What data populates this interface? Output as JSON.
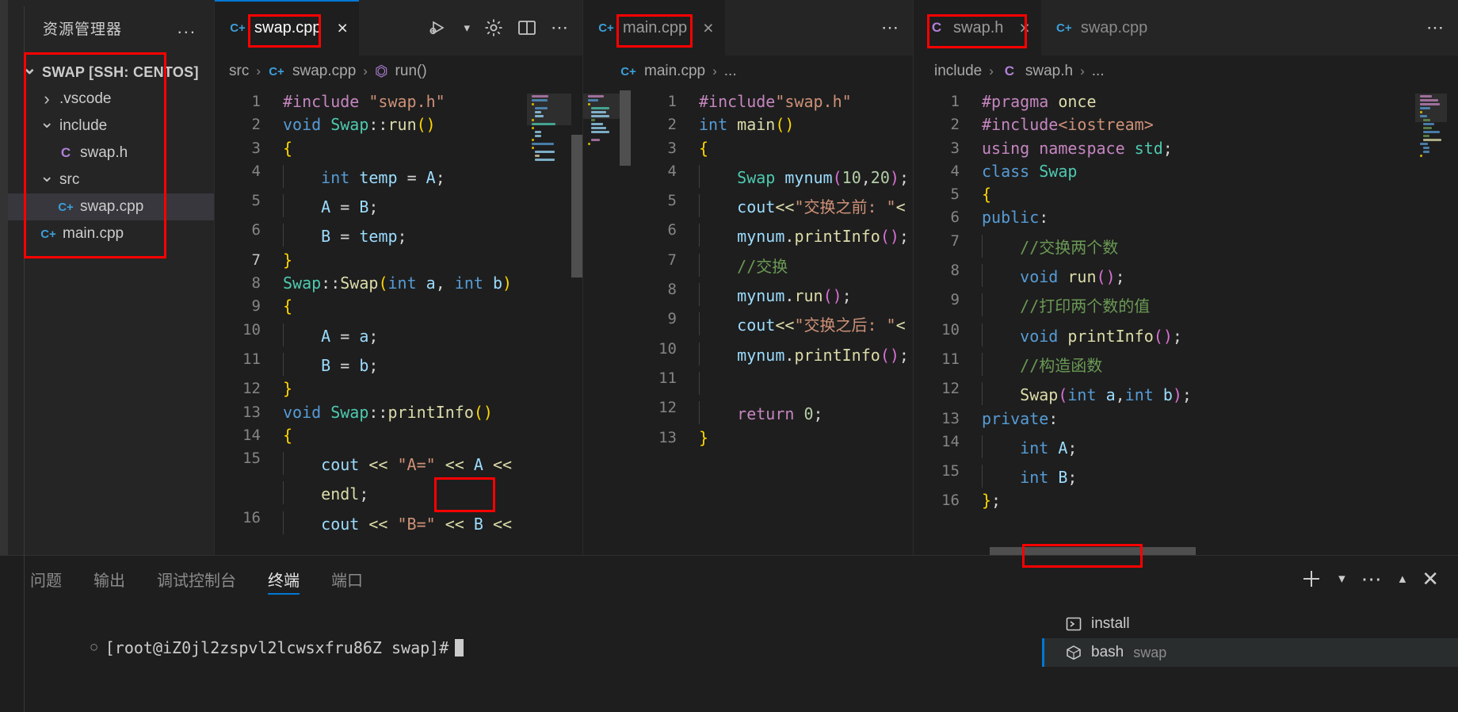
{
  "sidebar": {
    "title": "资源管理器",
    "more_label": "...",
    "root": "SWAP [SSH: CENTOS]",
    "items": [
      {
        "label": ".vscode",
        "kind": "folder",
        "state": "collapsed"
      },
      {
        "label": "include",
        "kind": "folder",
        "state": "expanded"
      },
      {
        "label": "swap.h",
        "kind": "header",
        "icon": "C"
      },
      {
        "label": "src",
        "kind": "folder",
        "state": "expanded"
      },
      {
        "label": "swap.cpp",
        "kind": "cpp",
        "icon": "C+",
        "selected": true
      },
      {
        "label": "main.cpp",
        "kind": "cpp",
        "icon": "C+"
      }
    ]
  },
  "groups": [
    {
      "tabs": [
        {
          "label": "swap.cpp",
          "icon": "cpp-file-icon",
          "active": true,
          "close": "×"
        }
      ],
      "actions": [
        "run-and-debug-icon",
        "chevron-down-icon",
        "gear-icon",
        "split-editor-icon",
        "more-actions-icon"
      ],
      "breadcrumb": [
        "src",
        "swap.cpp",
        "run()"
      ],
      "lines": [
        {
          "n": "1",
          "tokens": [
            {
              "t": "#include ",
              "c": "pp"
            },
            {
              "t": "\"swap.h\"",
              "c": "str"
            }
          ]
        },
        {
          "n": "2",
          "tokens": [
            {
              "t": "void ",
              "c": "kw"
            },
            {
              "t": "Swap",
              "c": "typ"
            },
            {
              "t": "::",
              "c": "op"
            },
            {
              "t": "run",
              "c": "fn"
            },
            {
              "t": "(",
              "c": "b1"
            },
            {
              "t": ")",
              "c": "b1"
            }
          ]
        },
        {
          "n": "3",
          "tokens": [
            {
              "t": "{",
              "c": "b1"
            }
          ]
        },
        {
          "n": "4",
          "indent": 1,
          "tokens": [
            {
              "t": "int ",
              "c": "kw"
            },
            {
              "t": "temp ",
              "c": "var"
            },
            {
              "t": "= ",
              "c": "op"
            },
            {
              "t": "A",
              "c": "var"
            },
            {
              "t": ";",
              "c": "op"
            }
          ]
        },
        {
          "n": "5",
          "indent": 1,
          "tokens": [
            {
              "t": "A ",
              "c": "var"
            },
            {
              "t": "= ",
              "c": "op"
            },
            {
              "t": "B",
              "c": "var"
            },
            {
              "t": ";",
              "c": "op"
            }
          ]
        },
        {
          "n": "6",
          "indent": 1,
          "tokens": [
            {
              "t": "B ",
              "c": "var"
            },
            {
              "t": "= ",
              "c": "op"
            },
            {
              "t": "temp",
              "c": "var"
            },
            {
              "t": ";",
              "c": "op"
            }
          ]
        },
        {
          "n": "7",
          "current": true,
          "tokens": [
            {
              "t": "}",
              "c": "b1"
            }
          ]
        },
        {
          "n": "8",
          "tokens": [
            {
              "t": "Swap",
              "c": "typ"
            },
            {
              "t": "::",
              "c": "op"
            },
            {
              "t": "Swap",
              "c": "fn"
            },
            {
              "t": "(",
              "c": "b1"
            },
            {
              "t": "int ",
              "c": "kw"
            },
            {
              "t": "a",
              "c": "var"
            },
            {
              "t": ", ",
              "c": "op"
            },
            {
              "t": "int ",
              "c": "kw"
            },
            {
              "t": "b",
              "c": "var"
            },
            {
              "t": ")",
              "c": "b1"
            }
          ]
        },
        {
          "n": "9",
          "tokens": [
            {
              "t": "{",
              "c": "b1"
            }
          ]
        },
        {
          "n": "10",
          "indent": 1,
          "tokens": [
            {
              "t": "A ",
              "c": "var"
            },
            {
              "t": "= ",
              "c": "op"
            },
            {
              "t": "a",
              "c": "var"
            },
            {
              "t": ";",
              "c": "op"
            }
          ]
        },
        {
          "n": "11",
          "indent": 1,
          "tokens": [
            {
              "t": "B ",
              "c": "var"
            },
            {
              "t": "= ",
              "c": "op"
            },
            {
              "t": "b",
              "c": "var"
            },
            {
              "t": ";",
              "c": "op"
            }
          ]
        },
        {
          "n": "12",
          "tokens": [
            {
              "t": "}",
              "c": "b1"
            }
          ]
        },
        {
          "n": "13",
          "tokens": [
            {
              "t": "void ",
              "c": "kw"
            },
            {
              "t": "Swap",
              "c": "typ"
            },
            {
              "t": "::",
              "c": "op"
            },
            {
              "t": "printInfo",
              "c": "fn"
            },
            {
              "t": "(",
              "c": "b1"
            },
            {
              "t": ")",
              "c": "b1"
            }
          ]
        },
        {
          "n": "14",
          "tokens": [
            {
              "t": "{",
              "c": "b1"
            }
          ]
        },
        {
          "n": "15",
          "indent": 1,
          "tokens": [
            {
              "t": "cout ",
              "c": "var"
            },
            {
              "t": "<< ",
              "c": "fn"
            },
            {
              "t": "\"A=\"",
              "c": "str"
            },
            {
              "t": " << ",
              "c": "fn"
            },
            {
              "t": "A",
              "c": "var"
            },
            {
              "t": " <<",
              "c": "fn"
            }
          ]
        },
        {
          "n": "",
          "indent": 1,
          "tokens": [
            {
              "t": "endl",
              "c": "fn"
            },
            {
              "t": ";",
              "c": "op"
            }
          ]
        },
        {
          "n": "16",
          "indent": 1,
          "tokens": [
            {
              "t": "cout ",
              "c": "var"
            },
            {
              "t": "<< ",
              "c": "fn"
            },
            {
              "t": "\"B=\"",
              "c": "str"
            },
            {
              "t": " << ",
              "c": "fn"
            },
            {
              "t": "B",
              "c": "var"
            },
            {
              "t": " <<",
              "c": "fn"
            }
          ]
        }
      ]
    },
    {
      "tabs": [
        {
          "label": "main.cpp",
          "icon": "cpp-file-icon",
          "active": true,
          "close": "×"
        }
      ],
      "actions": [
        "more-actions-icon"
      ],
      "breadcrumb": [
        "main.cpp",
        "..."
      ],
      "lines": [
        {
          "n": "1",
          "tokens": [
            {
              "t": "#include",
              "c": "pp"
            },
            {
              "t": "\"swap.h\"",
              "c": "str"
            }
          ]
        },
        {
          "n": "2",
          "tokens": [
            {
              "t": "int ",
              "c": "kw"
            },
            {
              "t": "main",
              "c": "fn"
            },
            {
              "t": "(",
              "c": "b1"
            },
            {
              "t": ")",
              "c": "b1"
            }
          ]
        },
        {
          "n": "3",
          "tokens": [
            {
              "t": "{",
              "c": "b1"
            }
          ]
        },
        {
          "n": "4",
          "indent": 1,
          "tokens": [
            {
              "t": "Swap ",
              "c": "typ"
            },
            {
              "t": "mynum",
              "c": "var"
            },
            {
              "t": "(",
              "c": "b2"
            },
            {
              "t": "10",
              "c": "num2"
            },
            {
              "t": ",",
              "c": "op"
            },
            {
              "t": "20",
              "c": "num2"
            },
            {
              "t": ")",
              "c": "b2"
            },
            {
              "t": ";",
              "c": "op"
            }
          ]
        },
        {
          "n": "5",
          "indent": 1,
          "tokens": [
            {
              "t": "cout",
              "c": "var"
            },
            {
              "t": "<<",
              "c": "fn"
            },
            {
              "t": "\"交换之前: \"",
              "c": "str"
            },
            {
              "t": "<",
              "c": "fn"
            }
          ]
        },
        {
          "n": "6",
          "indent": 1,
          "tokens": [
            {
              "t": "mynum",
              "c": "var"
            },
            {
              "t": ".",
              "c": "op"
            },
            {
              "t": "printInfo",
              "c": "fn"
            },
            {
              "t": "(",
              "c": "b2"
            },
            {
              "t": ")",
              "c": "b2"
            },
            {
              "t": ";",
              "c": "op"
            }
          ]
        },
        {
          "n": "7",
          "indent": 1,
          "tokens": [
            {
              "t": "//交换",
              "c": "cmt"
            }
          ]
        },
        {
          "n": "8",
          "indent": 1,
          "tokens": [
            {
              "t": "mynum",
              "c": "var"
            },
            {
              "t": ".",
              "c": "op"
            },
            {
              "t": "run",
              "c": "fn"
            },
            {
              "t": "(",
              "c": "b2"
            },
            {
              "t": ")",
              "c": "b2"
            },
            {
              "t": ";",
              "c": "op"
            }
          ]
        },
        {
          "n": "9",
          "indent": 1,
          "tokens": [
            {
              "t": "cout",
              "c": "var"
            },
            {
              "t": "<<",
              "c": "fn"
            },
            {
              "t": "\"交换之后: \"",
              "c": "str"
            },
            {
              "t": "<",
              "c": "fn"
            }
          ]
        },
        {
          "n": "10",
          "indent": 1,
          "tokens": [
            {
              "t": "mynum",
              "c": "var"
            },
            {
              "t": ".",
              "c": "op"
            },
            {
              "t": "printInfo",
              "c": "fn"
            },
            {
              "t": "(",
              "c": "b2"
            },
            {
              "t": ")",
              "c": "b2"
            },
            {
              "t": ";",
              "c": "op"
            }
          ]
        },
        {
          "n": "11",
          "indent": 1,
          "tokens": []
        },
        {
          "n": "12",
          "indent": 1,
          "tokens": [
            {
              "t": "return ",
              "c": "pp"
            },
            {
              "t": "0",
              "c": "num2"
            },
            {
              "t": ";",
              "c": "op"
            }
          ]
        },
        {
          "n": "13",
          "tokens": [
            {
              "t": "}",
              "c": "b1"
            }
          ]
        }
      ]
    },
    {
      "tabs": [
        {
          "label": "swap.h",
          "icon": "c-header-file-icon",
          "active": true,
          "close": "×"
        },
        {
          "label": "swap.cpp",
          "icon": "cpp-file-icon",
          "active": false
        }
      ],
      "actions": [
        "more-actions-icon"
      ],
      "breadcrumb": [
        "include",
        "swap.h",
        "..."
      ],
      "lines": [
        {
          "n": "1",
          "tokens": [
            {
              "t": "#pragma ",
              "c": "pp"
            },
            {
              "t": "once",
              "c": "fn"
            }
          ]
        },
        {
          "n": "2",
          "tokens": [
            {
              "t": "#include",
              "c": "pp"
            },
            {
              "t": "<iostream>",
              "c": "str"
            }
          ]
        },
        {
          "n": "3",
          "tokens": [
            {
              "t": "using ",
              "c": "pp"
            },
            {
              "t": "namespace ",
              "c": "pp"
            },
            {
              "t": "std",
              "c": "typ"
            },
            {
              "t": ";",
              "c": "op"
            }
          ]
        },
        {
          "n": "4",
          "tokens": [
            {
              "t": "class ",
              "c": "kw"
            },
            {
              "t": "Swap",
              "c": "typ"
            }
          ]
        },
        {
          "n": "5",
          "tokens": [
            {
              "t": "{",
              "c": "b1"
            }
          ]
        },
        {
          "n": "6",
          "tokens": [
            {
              "t": "public",
              "c": "kw"
            },
            {
              "t": ":",
              "c": "op"
            }
          ]
        },
        {
          "n": "7",
          "indent": 1,
          "tokens": [
            {
              "t": "//交换两个数",
              "c": "cmt"
            }
          ]
        },
        {
          "n": "8",
          "indent": 1,
          "tokens": [
            {
              "t": "void ",
              "c": "kw"
            },
            {
              "t": "run",
              "c": "fn"
            },
            {
              "t": "(",
              "c": "b2"
            },
            {
              "t": ")",
              "c": "b2"
            },
            {
              "t": ";",
              "c": "op"
            }
          ]
        },
        {
          "n": "9",
          "indent": 1,
          "tokens": [
            {
              "t": "//打印两个数的值",
              "c": "cmt"
            }
          ]
        },
        {
          "n": "10",
          "indent": 1,
          "tokens": [
            {
              "t": "void ",
              "c": "kw"
            },
            {
              "t": "printInfo",
              "c": "fn"
            },
            {
              "t": "(",
              "c": "b2"
            },
            {
              "t": ")",
              "c": "b2"
            },
            {
              "t": ";",
              "c": "op"
            }
          ]
        },
        {
          "n": "11",
          "indent": 1,
          "tokens": [
            {
              "t": "//构造函数",
              "c": "cmt"
            }
          ]
        },
        {
          "n": "12",
          "indent": 1,
          "tokens": [
            {
              "t": "Swap",
              "c": "fn"
            },
            {
              "t": "(",
              "c": "b2"
            },
            {
              "t": "int ",
              "c": "kw"
            },
            {
              "t": "a",
              "c": "var"
            },
            {
              "t": ",",
              "c": "op"
            },
            {
              "t": "int ",
              "c": "kw"
            },
            {
              "t": "b",
              "c": "var"
            },
            {
              "t": ")",
              "c": "b2"
            },
            {
              "t": ";",
              "c": "op"
            }
          ]
        },
        {
          "n": "13",
          "tokens": [
            {
              "t": "private",
              "c": "kw"
            },
            {
              "t": ":",
              "c": "op"
            }
          ]
        },
        {
          "n": "14",
          "indent": 1,
          "tokens": [
            {
              "t": "int ",
              "c": "kw"
            },
            {
              "t": "A",
              "c": "var"
            },
            {
              "t": ";",
              "c": "op"
            }
          ]
        },
        {
          "n": "15",
          "indent": 1,
          "tokens": [
            {
              "t": "int ",
              "c": "kw"
            },
            {
              "t": "B",
              "c": "var"
            },
            {
              "t": ";",
              "c": "op"
            }
          ]
        },
        {
          "n": "16",
          "tokens": [
            {
              "t": "}",
              "c": "b1"
            },
            {
              "t": ";",
              "c": "op"
            }
          ]
        }
      ]
    }
  ],
  "panel": {
    "tabs": [
      {
        "label": "问题",
        "active": false
      },
      {
        "label": "输出",
        "active": false
      },
      {
        "label": "调试控制台",
        "active": false
      },
      {
        "label": "终端",
        "active": true
      },
      {
        "label": "端口",
        "active": false
      }
    ],
    "actions": [
      "new-terminal-icon",
      "chevron-down-icon",
      "more-actions-icon",
      "chevron-up-icon",
      "close-icon"
    ],
    "terminal_line": "[root@iZ0jl2zspvl2lcwsxfru86Z swap]#",
    "terminal_items": [
      {
        "label": "install",
        "sub": "",
        "icon": "terminal-icon",
        "active": false
      },
      {
        "label": "bash",
        "sub": "swap",
        "icon": "cube-icon",
        "active": true
      }
    ]
  },
  "colors": {
    "accent": "#0078d4",
    "annotation": "#ff0000",
    "editor_bg": "#1e1e1e",
    "sidebar_bg": "#252526"
  }
}
